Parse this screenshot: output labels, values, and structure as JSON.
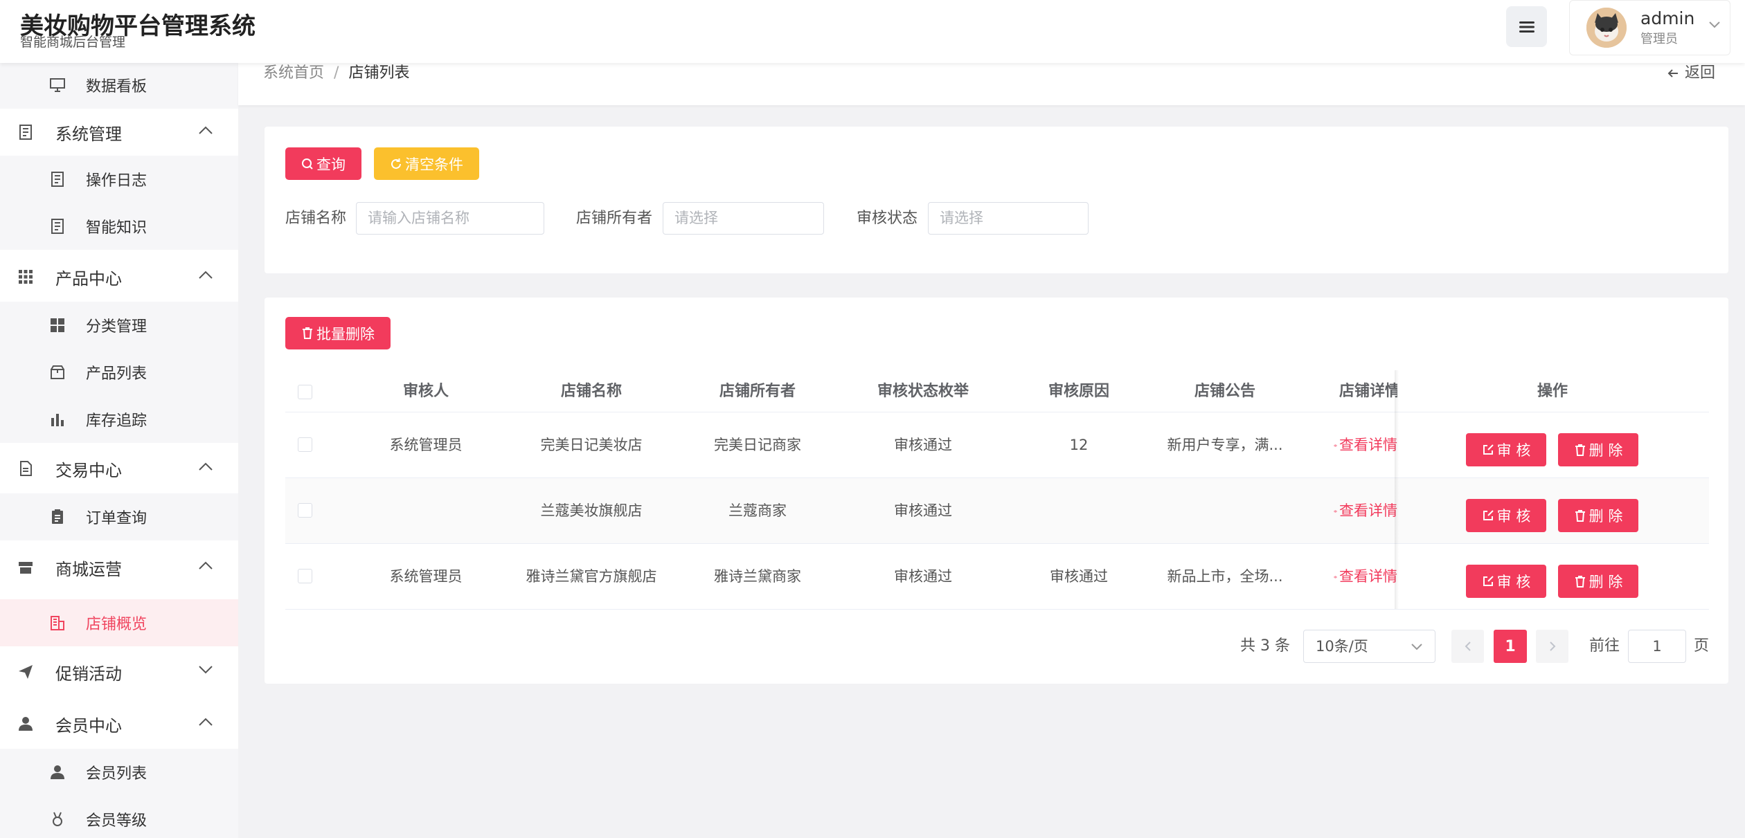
{
  "app": {
    "title": "美妆购物平台管理系统",
    "subtitle": "智能商城后台管理"
  },
  "user": {
    "name": "admin",
    "role": "管理员"
  },
  "sidebar": {
    "data_board": "数据看板",
    "system": {
      "label": "系统管理",
      "items": [
        "操作日志",
        "智能知识"
      ]
    },
    "product": {
      "label": "产品中心",
      "items": [
        "分类管理",
        "产品列表",
        "库存追踪"
      ]
    },
    "trade": {
      "label": "交易中心",
      "items": [
        "订单查询"
      ]
    },
    "mall": {
      "label": "商城运营",
      "items": [
        "店铺概览"
      ]
    },
    "promo": {
      "label": "促销活动"
    },
    "member": {
      "label": "会员中心",
      "items": [
        "会员列表",
        "会员等级"
      ]
    }
  },
  "breadcrumb": {
    "home": "系统首页",
    "sep": "/",
    "current": "店铺列表"
  },
  "back_label": "返回",
  "filters": {
    "query_label": "查询",
    "clear_label": "清空条件",
    "shop_name_label": "店铺名称",
    "shop_name_placeholder": "请输入店铺名称",
    "owner_label": "店铺所有者",
    "owner_placeholder": "请选择",
    "status_label": "审核状态",
    "status_placeholder": "请选择"
  },
  "batch_delete_label": "批量删除",
  "table": {
    "columns": [
      "审核人",
      "店铺名称",
      "店铺所有者",
      "审核状态枚举",
      "审核原因",
      "店铺公告",
      "店铺详情",
      "操作"
    ],
    "rows": [
      {
        "reviewer": "系统管理员",
        "shop": "完美日记美妆店",
        "owner": "完美日记商家",
        "status": "审核通过",
        "reason": "12",
        "notice": "新用户专享，满...",
        "detail": "查看详情",
        "audit": "审 核",
        "delete": "删 除"
      },
      {
        "reviewer": "",
        "shop": "兰蔻美妆旗舰店",
        "owner": "兰蔻商家",
        "status": "审核通过",
        "reason": "",
        "notice": "",
        "detail": "查看详情",
        "audit": "审 核",
        "delete": "删 除"
      },
      {
        "reviewer": "系统管理员",
        "shop": "雅诗兰黛官方旗舰店",
        "owner": "雅诗兰黛商家",
        "status": "审核通过",
        "reason": "审核通过",
        "notice": "新品上市，全场...",
        "detail": "查看详情",
        "audit": "审 核",
        "delete": "删 除"
      }
    ]
  },
  "pagination": {
    "total": "共 3 条",
    "page_size": "10条/页",
    "current": "1",
    "goto_label": "前往",
    "goto_value": "1",
    "page_suffix": "页"
  },
  "colors": {
    "primary": "#f23b5c",
    "warning": "#fbc02d",
    "active_bg": "#fdeef0"
  }
}
